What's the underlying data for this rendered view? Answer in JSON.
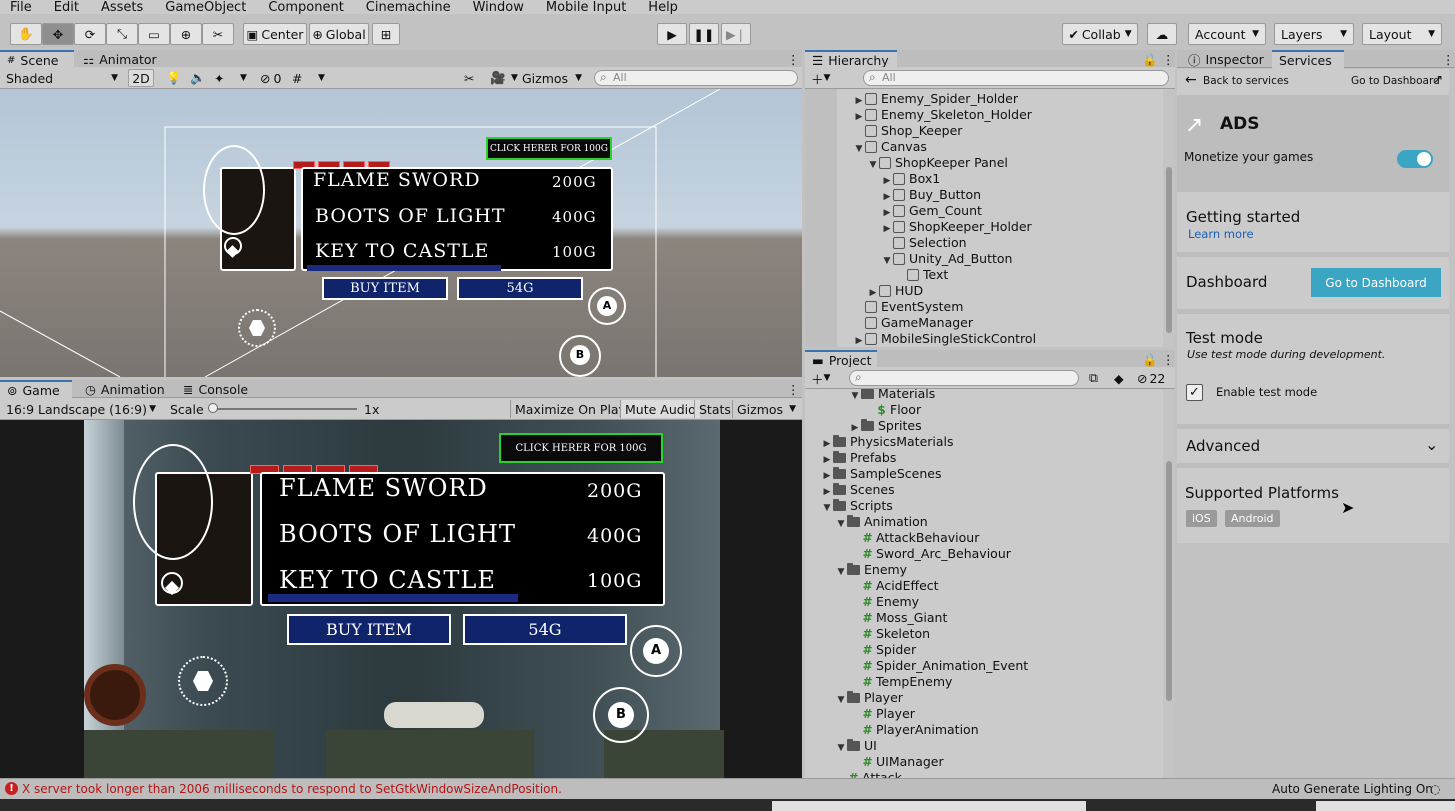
{
  "menu": [
    "File",
    "Edit",
    "Assets",
    "GameObject",
    "Component",
    "Cinemachine",
    "Window",
    "Mobile Input",
    "Help"
  ],
  "toolbar": {
    "pivot": "Center",
    "space": "Global",
    "collab": "Collab",
    "account": "Account",
    "layers": "Layers",
    "layout": "Layout"
  },
  "scene": {
    "tab_scene": "Scene",
    "tab_animator": "Animator",
    "shading": "Shaded",
    "mode_2d": "2D",
    "hidden_count": "0",
    "gizmos": "Gizmos",
    "search_placeholder": "All"
  },
  "game": {
    "tab_game": "Game",
    "tab_animation": "Animation",
    "tab_console": "Console",
    "aspect": "16:9 Landscape (16:9)",
    "scale_label": "Scale",
    "scale_value": "1x",
    "maximize": "Maximize On Play",
    "mute": "Mute Audio",
    "stats": "Stats",
    "gizmos": "Gizmos"
  },
  "shop": {
    "items": [
      {
        "name": "FLAME SWORD",
        "price": "200G"
      },
      {
        "name": "BOOTS OF LIGHT",
        "price": "400G"
      },
      {
        "name": "KEY TO CASTLE",
        "price": "100G"
      }
    ],
    "buy_label": "BUY ITEM",
    "gems_label": "54G",
    "ad_label_game": "CLICK HERER FOR 100G",
    "ad_label_scene": "CLICK HERER FOR 100G",
    "btn_a": "A",
    "btn_b": "B"
  },
  "hierarchy": {
    "title": "Hierarchy",
    "search_placeholder": "All",
    "rows": [
      {
        "label": "Enemy_Spider_Holder",
        "indent": 0,
        "arrow": "▶"
      },
      {
        "label": "Enemy_Skeleton_Holder",
        "indent": 0,
        "arrow": "▶"
      },
      {
        "label": "Shop_Keeper",
        "indent": 0,
        "arrow": ""
      },
      {
        "label": "Canvas",
        "indent": 0,
        "arrow": "▼"
      },
      {
        "label": "ShopKeeper Panel",
        "indent": 1,
        "arrow": "▼"
      },
      {
        "label": "Box1",
        "indent": 2,
        "arrow": "▶"
      },
      {
        "label": "Buy_Button",
        "indent": 2,
        "arrow": "▶"
      },
      {
        "label": "Gem_Count",
        "indent": 2,
        "arrow": "▶"
      },
      {
        "label": "ShopKeeper_Holder",
        "indent": 2,
        "arrow": "▶"
      },
      {
        "label": "Selection",
        "indent": 2,
        "arrow": ""
      },
      {
        "label": "Unity_Ad_Button",
        "indent": 2,
        "arrow": "▼"
      },
      {
        "label": "Text",
        "indent": 3,
        "arrow": ""
      },
      {
        "label": "HUD",
        "indent": 1,
        "arrow": "▶"
      },
      {
        "label": "EventSystem",
        "indent": 0,
        "arrow": ""
      },
      {
        "label": "GameManager",
        "indent": 0,
        "arrow": ""
      },
      {
        "label": "MobileSingleStickControl",
        "indent": 0,
        "arrow": "▶"
      }
    ]
  },
  "project": {
    "title": "Project",
    "hidden_count": "22",
    "rows": [
      {
        "label": "Materials",
        "indent": 2,
        "type": "folder",
        "arrow": "▼"
      },
      {
        "label": "Floor",
        "indent": 3,
        "type": "material",
        "arrow": ""
      },
      {
        "label": "Sprites",
        "indent": 2,
        "type": "folder",
        "arrow": "▶"
      },
      {
        "label": "PhysicsMaterials",
        "indent": 0,
        "type": "folder",
        "arrow": "▶"
      },
      {
        "label": "Prefabs",
        "indent": 0,
        "type": "folder",
        "arrow": "▶"
      },
      {
        "label": "SampleScenes",
        "indent": 0,
        "type": "folder",
        "arrow": "▶"
      },
      {
        "label": "Scenes",
        "indent": 0,
        "type": "folder",
        "arrow": "▶"
      },
      {
        "label": "Scripts",
        "indent": 0,
        "type": "folder",
        "arrow": "▼"
      },
      {
        "label": "Animation",
        "indent": 1,
        "type": "folder",
        "arrow": "▼"
      },
      {
        "label": "AttackBehaviour",
        "indent": 2,
        "type": "script",
        "arrow": ""
      },
      {
        "label": "Sword_Arc_Behaviour",
        "indent": 2,
        "type": "script",
        "arrow": ""
      },
      {
        "label": "Enemy",
        "indent": 1,
        "type": "folder",
        "arrow": "▼"
      },
      {
        "label": "AcidEffect",
        "indent": 2,
        "type": "script",
        "arrow": ""
      },
      {
        "label": "Enemy",
        "indent": 2,
        "type": "script",
        "arrow": ""
      },
      {
        "label": "Moss_Giant",
        "indent": 2,
        "type": "script",
        "arrow": ""
      },
      {
        "label": "Skeleton",
        "indent": 2,
        "type": "script",
        "arrow": ""
      },
      {
        "label": "Spider",
        "indent": 2,
        "type": "script",
        "arrow": ""
      },
      {
        "label": "Spider_Animation_Event",
        "indent": 2,
        "type": "script",
        "arrow": ""
      },
      {
        "label": "TempEnemy",
        "indent": 2,
        "type": "script",
        "arrow": ""
      },
      {
        "label": "Player",
        "indent": 1,
        "type": "folder",
        "arrow": "▼"
      },
      {
        "label": "Player",
        "indent": 2,
        "type": "script",
        "arrow": ""
      },
      {
        "label": "PlayerAnimation",
        "indent": 2,
        "type": "script",
        "arrow": ""
      },
      {
        "label": "UI",
        "indent": 1,
        "type": "folder",
        "arrow": "▼"
      },
      {
        "label": "UIManager",
        "indent": 2,
        "type": "script",
        "arrow": ""
      },
      {
        "label": "Attack",
        "indent": 1,
        "type": "script",
        "arrow": ""
      }
    ]
  },
  "services": {
    "tab_inspector": "Inspector",
    "tab_services": "Services",
    "back": "Back to services",
    "goto_dashboard_link": "Go to Dashboard",
    "title": "ADS",
    "monetize": "Monetize your games",
    "getting_started": "Getting started",
    "learn_more": "Learn more",
    "dashboard": "Dashboard",
    "dashboard_button": "Go to Dashboard",
    "test_mode": "Test mode",
    "test_mode_desc": "Use test mode during development.",
    "enable_test_mode": "Enable test mode",
    "advanced": "Advanced",
    "supported_platforms": "Supported Platforms",
    "platforms": [
      "iOS",
      "Android"
    ],
    "accent": "#3aa6c4"
  },
  "status": {
    "error": "X server took longer than 2006 milliseconds to respond to SetGtkWindowSizeAndPosition.",
    "lighting": "Auto Generate Lighting On"
  }
}
